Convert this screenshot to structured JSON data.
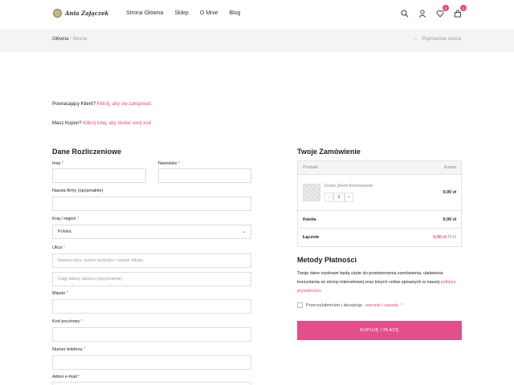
{
  "header": {
    "logo_text": "Ania Zajączek",
    "nav": [
      "Strona Główna",
      "Sklep",
      "O Mnie",
      "Blog"
    ],
    "wishlist_count": "0",
    "cart_count": "1"
  },
  "breadcrumb": {
    "home": "Główna",
    "separator": " / ",
    "current": "Strona",
    "prev_link": "Poprzednia strona"
  },
  "notices": {
    "login_prefix": "Powracający Klient?",
    "login_link": "Kliknij, aby się zalogować",
    "coupon_prefix": "Masz Kupon?",
    "coupon_link": "Kliknij tutaj, aby dodać swój kod"
  },
  "billing": {
    "title": "Dane Rozliczeniowe",
    "first_name_label": "Imię",
    "last_name_label": "Nazwisko",
    "company_label": "Nazwa firmy (opcjonalnie)",
    "country_label": "Kraj / region",
    "country_value": "Polska",
    "street_label": "Ulica",
    "street_placeholder": "Nazwa ulicy, numer budynku / numer lokalu",
    "street2_placeholder": "Ciąg dalszy adresu (opcjonalnie)",
    "city_label": "Miasto",
    "postcode_label": "Kod pocztowy",
    "phone_label": "Numer telefonu",
    "email_label": "Adres e-mail",
    "required_mark": "*"
  },
  "order": {
    "title": "Twoje Zamówienie",
    "col_product": "Produkt",
    "col_amount": "Kwota",
    "product_name": "Dzień Ziemi Kolorowanki",
    "qty_minus": "−",
    "qty_value": "1",
    "qty_plus": "+",
    "product_price": "0,00 zł",
    "subtotal_label": "Kwota",
    "subtotal_value": "0,00 zł",
    "total_label": "Łącznie",
    "total_value": "0,00 zł",
    "total_currency": "PLN"
  },
  "payment": {
    "title": "Metody Płatności",
    "privacy_text": "Twoje dane osobowe będą użyte do przetworzenia zamówienia, ułatwienia korzystania ze strony internetowej oraz innych celów opisanych w naszej",
    "privacy_link": "polityka prywatności",
    "terms_text": "Przeczytałem/am i akceptuję",
    "terms_link": "warunki i zasady",
    "button_label": "KUPUJĘ I PŁACĘ"
  },
  "colors": {
    "accent": "#e24f8d"
  }
}
